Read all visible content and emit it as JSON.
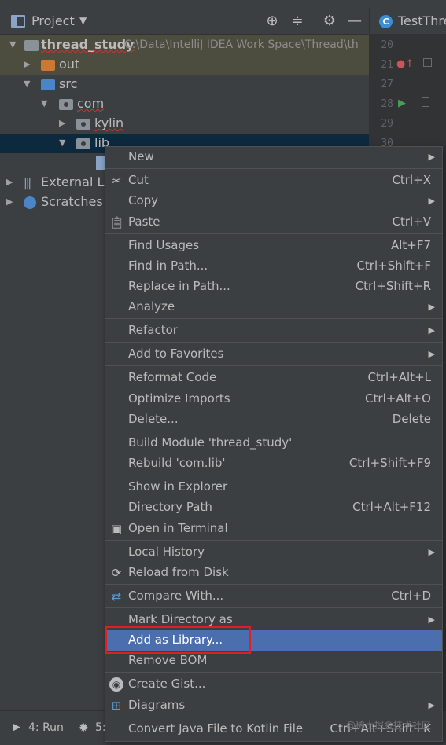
{
  "panel": {
    "title": "Project",
    "toolbar_icons": [
      "crosshair-icon",
      "collapse-icon",
      "gear-icon",
      "minimize-icon"
    ]
  },
  "editor_tab": {
    "label": "TestThre"
  },
  "gutter": {
    "line_numbers": [
      "20",
      "21",
      "27",
      "28",
      "29",
      "30"
    ]
  },
  "tree": {
    "root": {
      "label": "thread_study",
      "path": "C:\\Data\\IntelliJ IDEA Work Space\\Thread\\th"
    },
    "out": "out",
    "src": "src",
    "com": "com",
    "kylin": "kylin",
    "lib": "lib",
    "external": "External Lib",
    "scratches": "Scratches a"
  },
  "context_menu": {
    "new": "New",
    "cut": "Cut",
    "cut_key": "Ctrl+X",
    "copy": "Copy",
    "paste": "Paste",
    "paste_key": "Ctrl+V",
    "find_usages": "Find Usages",
    "find_usages_key": "Alt+F7",
    "find_in_path": "Find in Path...",
    "find_in_path_key": "Ctrl+Shift+F",
    "replace_in_path": "Replace in Path...",
    "replace_in_path_key": "Ctrl+Shift+R",
    "analyze": "Analyze",
    "refactor": "Refactor",
    "add_to_favorites": "Add to Favorites",
    "reformat_code": "Reformat Code",
    "reformat_code_key": "Ctrl+Alt+L",
    "optimize_imports": "Optimize Imports",
    "optimize_imports_key": "Ctrl+Alt+O",
    "delete": "Delete...",
    "delete_key": "Delete",
    "build_module": "Build Module 'thread_study'",
    "rebuild": "Rebuild 'com.lib'",
    "rebuild_key": "Ctrl+Shift+F9",
    "show_in_explorer": "Show in Explorer",
    "directory_path": "Directory Path",
    "directory_path_key": "Ctrl+Alt+F12",
    "open_in_terminal": "Open in Terminal",
    "local_history": "Local History",
    "reload_from_disk": "Reload from Disk",
    "compare_with": "Compare With...",
    "compare_with_key": "Ctrl+D",
    "mark_directory_as": "Mark Directory as",
    "add_as_library": "Add as Library...",
    "remove_bom": "Remove BOM",
    "create_gist": "Create Gist...",
    "diagrams": "Diagrams",
    "convert_java": "Convert Java File to Kotlin File",
    "convert_java_key": "Ctrl+Alt+Shift+K"
  },
  "bottom_bar": {
    "run": "4: Run",
    "second": "5:"
  },
  "watermark": "@稀土掘金技术社区",
  "colors": {
    "menu_highlight": "#4b6eaf",
    "annotation_box": "#e02020",
    "panel_bg": "#3c3f41"
  }
}
